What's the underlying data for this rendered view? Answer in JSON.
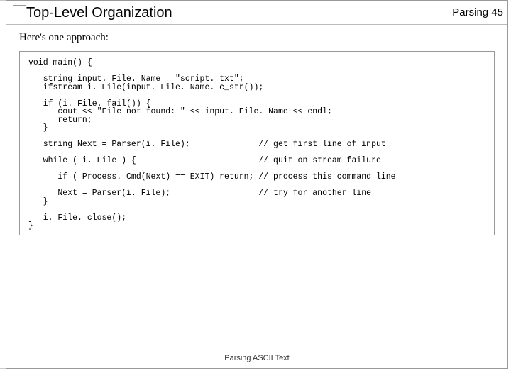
{
  "header": {
    "title": "Top-Level Organization",
    "section": "Parsing",
    "page": "45"
  },
  "content": {
    "lead": "Here's one approach:",
    "code": "void main() {\n\n   string input. File. Name = \"script. txt\";\n   ifstream i. File(input. File. Name. c_str());\n\n   if (i. File. fail()) {\n      cout << \"File not found: \" << input. File. Name << endl;\n      return;\n   }\n\n   string Next = Parser(i. File);              // get first line of input\n\n   while ( i. File ) {                         // quit on stream failure\n\n      if ( Process. Cmd(Next) == EXIT) return; // process this command line\n\n      Next = Parser(i. File);                  // try for another line\n   }\n\n   i. File. close();\n}"
  },
  "footer": {
    "text": "Parsing ASCII Text"
  }
}
